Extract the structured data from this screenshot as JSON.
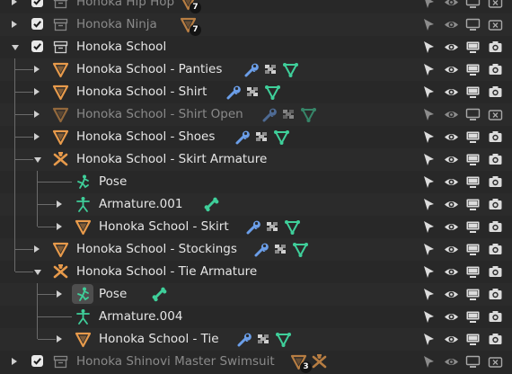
{
  "outliner": {
    "rows": [
      {
        "label": "Honoka Hip Hop",
        "kind": "collection",
        "checked": true,
        "dim": true,
        "badge": "7"
      },
      {
        "label": "Honoka Ninja",
        "kind": "collection",
        "checked": true,
        "dim": true,
        "badge": "7"
      },
      {
        "label": "Honoka School",
        "kind": "collection",
        "checked": true,
        "expanded": true
      },
      {
        "label": "Honoka School - Panties",
        "kind": "mesh",
        "modifiers": [
          "wrench-icon",
          "vertex-groups-icon",
          "shape-keys-icon"
        ]
      },
      {
        "label": "Honoka School - Shirt",
        "kind": "mesh",
        "modifiers": [
          "wrench-icon",
          "vertex-groups-icon",
          "shape-keys-icon"
        ]
      },
      {
        "label": "Honoka School - Shirt Open",
        "kind": "mesh",
        "dim": true,
        "render_disabled": true,
        "modifiers": [
          "wrench-icon",
          "vertex-groups-icon",
          "shape-keys-icon"
        ]
      },
      {
        "label": "Honoka School - Shoes",
        "kind": "mesh",
        "modifiers": [
          "wrench-icon",
          "vertex-groups-icon",
          "shape-keys-icon"
        ]
      },
      {
        "label": "Honoka School - Skirt Armature",
        "kind": "armature",
        "expanded": true
      },
      {
        "label": "Pose",
        "kind": "pose"
      },
      {
        "label": "Armature.001",
        "kind": "armature-data",
        "extra": "bone-icon"
      },
      {
        "label": "Honoka School - Skirt",
        "kind": "mesh",
        "modifiers": [
          "wrench-icon",
          "vertex-groups-icon",
          "shape-keys-icon"
        ]
      },
      {
        "label": "Honoka School - Stockings",
        "kind": "mesh",
        "modifiers": [
          "wrench-icon",
          "vertex-groups-icon",
          "shape-keys-icon"
        ]
      },
      {
        "label": "Honoka School - Tie Armature",
        "kind": "armature",
        "expanded": true
      },
      {
        "label": "Pose",
        "kind": "pose",
        "active": true,
        "extra": "bone-icon"
      },
      {
        "label": "Armature.004",
        "kind": "armature-data"
      },
      {
        "label": "Honoka School - Tie",
        "kind": "mesh",
        "modifiers": [
          "wrench-icon",
          "vertex-groups-icon",
          "shape-keys-icon"
        ]
      },
      {
        "label": "Honoka Shinovi Master Swimsuit",
        "kind": "collection",
        "checked": true,
        "dim": true,
        "badge": "3"
      }
    ]
  },
  "colors": {
    "background": "#282828",
    "mesh_orange": "#e79a4b",
    "armature_orange": "#e79a4b",
    "modifier_blue": "#6b9ee8",
    "data_green": "#3fcf9a",
    "text": "#e6e6e6",
    "text_dim": "#8a8a8a"
  },
  "restriction_icons": [
    "select-arrow-icon",
    "eye-icon",
    "viewport-monitor-icon",
    "render-camera-icon"
  ]
}
